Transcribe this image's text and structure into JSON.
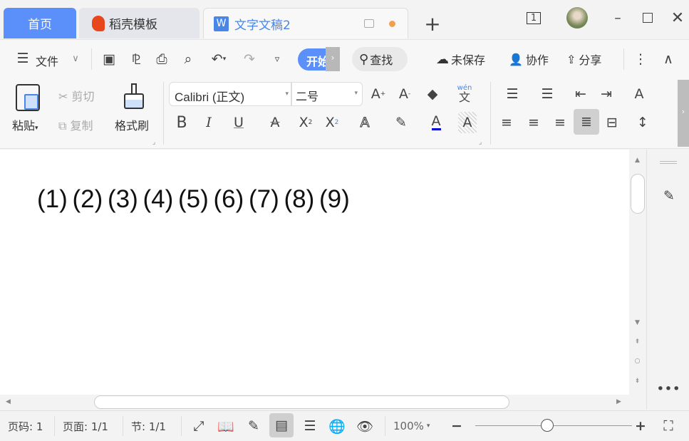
{
  "tabs": {
    "home": "首页",
    "template": "稻壳模板",
    "doc": "文字文稿2",
    "new_tab": "+"
  },
  "window": {
    "page_count_badge": "1"
  },
  "toolbar": {
    "file": "文件",
    "start": "开始",
    "find": "查找",
    "unsaved": "未保存",
    "collab": "协作",
    "share": "分享"
  },
  "ribbon": {
    "paste": "粘贴",
    "cut": "剪切",
    "copy": "复制",
    "format_painter": "格式刷",
    "font_name": "Calibri (正文)",
    "font_size": "二号",
    "bold": "B",
    "italic": "I",
    "underline": "U",
    "wen": "wén",
    "wen_char": "文"
  },
  "document": {
    "text": "(1) (2) (3) (4) (5) (6) (7) (8) (9)"
  },
  "status": {
    "page_no": "页码: 1",
    "pages": "页面: 1/1",
    "section": "节: 1/1",
    "zoom": "100%",
    "zoom_level": 100
  },
  "colors": {
    "accent": "#4a86e8",
    "home_tab": "#5b8ff9",
    "font_color": "#0000cc"
  }
}
